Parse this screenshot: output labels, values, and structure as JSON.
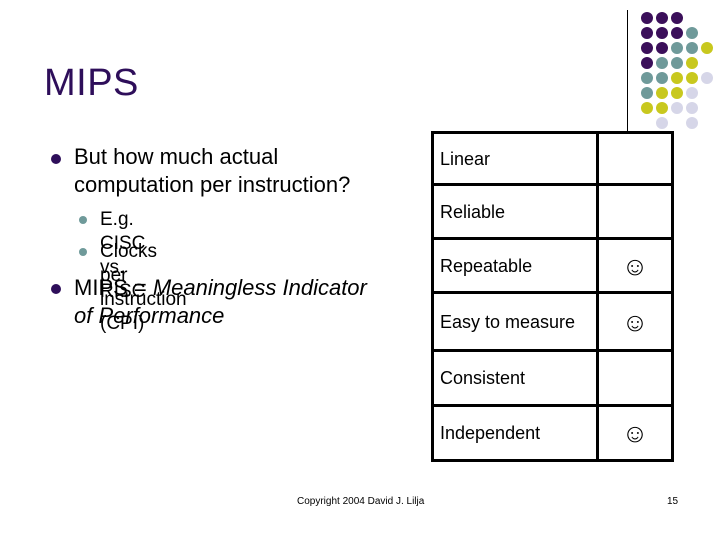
{
  "slide": {
    "title": "MIPS",
    "bullets": [
      {
        "line1": "But how much actual",
        "line2": "computation per instruction?",
        "sub": [
          "E.g. CISC vs. RISC",
          "Clocks per instruction (CPI)"
        ]
      },
      {
        "prefix": "MIPS = ",
        "italic_line1": "Meaningless Indicator",
        "italic_line2": "of Performance"
      }
    ],
    "table": {
      "rows": [
        {
          "label": "Linear",
          "mark": ""
        },
        {
          "label": "Reliable",
          "mark": ""
        },
        {
          "label": "Repeatable",
          "mark": "☺"
        },
        {
          "label": "Easy to measure",
          "mark": "☺"
        },
        {
          "label": "Consistent",
          "mark": ""
        },
        {
          "label": "Independent",
          "mark": "☺"
        }
      ]
    },
    "footer": {
      "copyright": "Copyright 2004 David J. Lilja",
      "page_number": "15"
    }
  },
  "theme": {
    "title_color": "#2E0E5A",
    "dot_colors": {
      "P": "#3B0F5A",
      "T": "#6F9A9A",
      "Y": "#C8C81E",
      "L": "#D6D6E8"
    },
    "dot_grid": [
      "PPP..",
      "PPPT.",
      "PPTTY",
      "PTTY.",
      "TTYYL",
      "TYYL.",
      "YYLL.",
      ".L.L."
    ]
  }
}
